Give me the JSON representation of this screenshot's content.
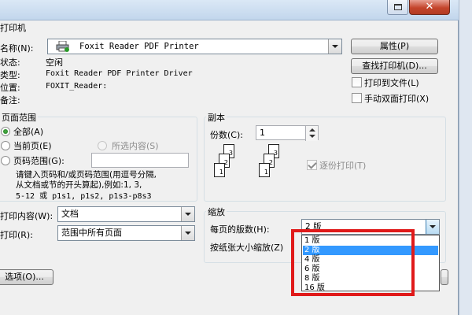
{
  "window": {
    "close_glyph": "✕"
  },
  "printer": {
    "group_title": "打印机",
    "name_label": "名称(N):",
    "name_value": "Foxit Reader PDF Printer",
    "properties_button": "属性(P)",
    "find_printer_button": "查找打印机(D)...",
    "status_label": "状态:",
    "status_value": "空闲",
    "type_label": "类型:",
    "type_value": "Foxit Reader PDF Printer Driver",
    "location_label": "位置:",
    "location_value": "FOXIT_Reader:",
    "comment_label": "备注:",
    "print_to_file_label": "打印到文件(L)",
    "manual_duplex_label": "手动双面打印(X)",
    "printer_icon": "printer-icon"
  },
  "page_range": {
    "group_title": "页面范围",
    "all_label": "全部(A)",
    "current_page_label": "当前页(E)",
    "selection_label": "所选内容(S)",
    "pages_label": "页码范围(G):",
    "pages_value": "",
    "help_line1": "请键入页码和/或页码范围(用逗号分隔,",
    "help_line2": "从文档或节的开头算起),例如:1, 3,",
    "help_line3": "5-12 或 p1s1, p1s2, p1s3-p8s3"
  },
  "copies": {
    "group_title": "副本",
    "count_label": "份数(C):",
    "count_value": "1",
    "collate_label": "逐份打印(T)",
    "page_numbers": [
      "1",
      "2",
      "3"
    ]
  },
  "print_what": {
    "label": "打印内容(W):",
    "value": "文档"
  },
  "print_range": {
    "label": "打印(R):",
    "value": "范围中所有页面"
  },
  "zoom": {
    "group_title": "缩放",
    "pages_per_sheet_label": "每页的版数(H):",
    "pages_per_sheet_value": "2 版",
    "scale_label": "按纸张大小缩放(Z)",
    "options": [
      "1 版",
      "2 版",
      "4 版",
      "6 版",
      "8 版",
      "16 版"
    ],
    "selected_option": "2 版"
  },
  "footer": {
    "options_button": "选项(O)..."
  },
  "colors": {
    "highlight": "#e01a1a",
    "selection": "#3399ff",
    "dialog_bg": "#f0f0f0"
  }
}
